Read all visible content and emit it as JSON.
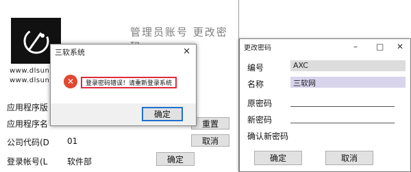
{
  "main": {
    "site_line1": "www.dlsun",
    "site_line2": "www.dlsun",
    "header_text": "管理员账号 更改密码",
    "rows": [
      {
        "label": "应用程序版"
      },
      {
        "label": "应用程序名"
      },
      {
        "label": "公司代码(D",
        "value": "01"
      },
      {
        "label": "登录帐号(L",
        "value": "软件部"
      }
    ],
    "buttons": {
      "right1": "重置",
      "right2": "取消",
      "ok": "确定"
    }
  },
  "message_box": {
    "title": "三软系统",
    "error_text": "登录密码错误！请重新登录系统",
    "ok_label": "确定"
  },
  "password_window": {
    "title": "更改密码",
    "minimize_glyph": "–",
    "maximize_glyph": "□",
    "close_glyph": "✕",
    "fields": [
      {
        "label": "编号",
        "value": "AXC"
      },
      {
        "label": "名称",
        "value": "三软网"
      },
      {
        "label": "原密码",
        "value": ""
      },
      {
        "label": "新密码",
        "value": ""
      },
      {
        "label": "确认新密码",
        "value": ""
      }
    ],
    "ok_label": "确定",
    "cancel_label": "取消"
  },
  "colors": {
    "error_icon": "#e2472f",
    "error_highlight": "#e0283a",
    "field_gray": "#dcdcdc",
    "field_lavender": "#d8d4ec"
  }
}
